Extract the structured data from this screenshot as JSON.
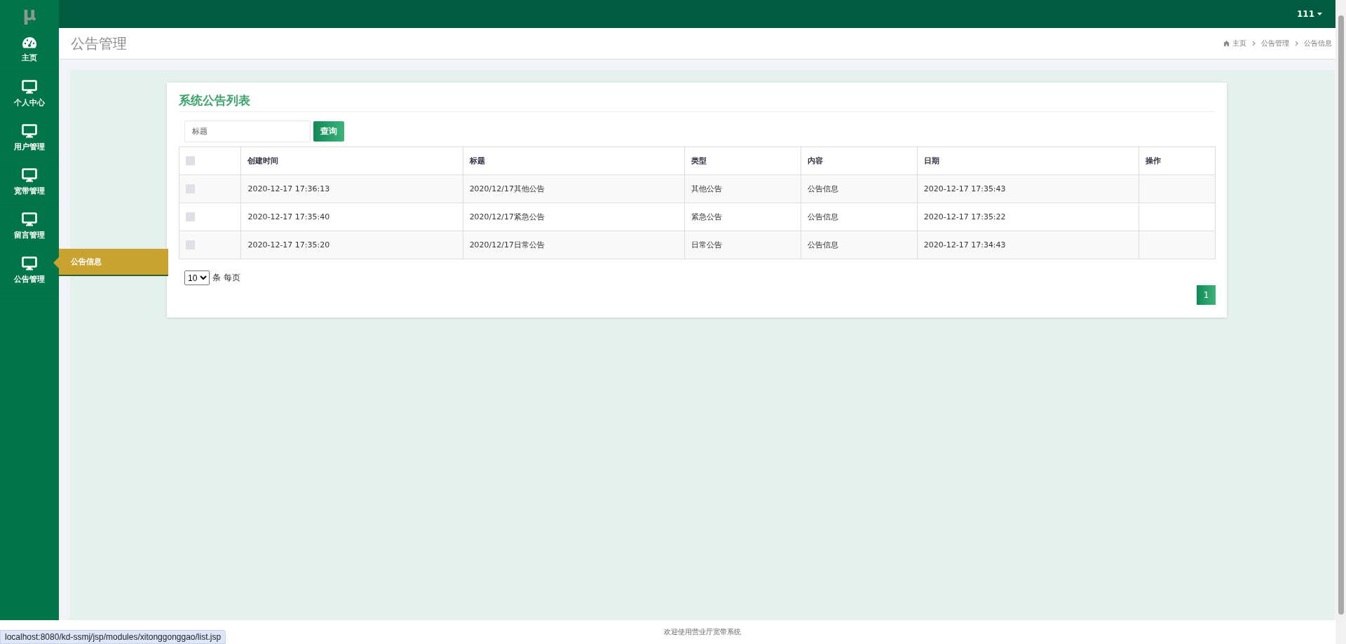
{
  "logo": "μ",
  "user_menu": {
    "label": "111"
  },
  "sidebar": {
    "items": [
      {
        "label": "主页",
        "kind": "dashboard",
        "expanded": false
      },
      {
        "label": "个人中心",
        "kind": "monitor",
        "expanded": false
      },
      {
        "label": "用户管理",
        "kind": "monitor",
        "expanded": false
      },
      {
        "label": "宽带管理",
        "kind": "monitor",
        "expanded": false
      },
      {
        "label": "留言管理",
        "kind": "monitor",
        "expanded": false
      },
      {
        "label": "公告管理",
        "kind": "monitor",
        "expanded": true,
        "submenu": [
          "公告信息"
        ]
      }
    ]
  },
  "page_title": "公告管理",
  "breadcrumb": [
    "主页",
    "公告管理",
    "公告信息"
  ],
  "card": {
    "title": "系统公告列表",
    "search": {
      "placeholder": "标题",
      "button": "查询"
    },
    "table": {
      "columns": [
        "创建时间",
        "标题",
        "类型",
        "内容",
        "日期",
        "操作"
      ],
      "header_checked": false,
      "rows": [
        {
          "checked": false,
          "cells": [
            "2020-12-17 17:36:13",
            "2020/12/17其他公告",
            "其他公告",
            "公告信息",
            "2020-12-17 17:35:43",
            ""
          ]
        },
        {
          "checked": false,
          "cells": [
            "2020-12-17 17:35:40",
            "2020/12/17紧急公告",
            "紧急公告",
            "公告信息",
            "2020-12-17 17:35:22",
            ""
          ]
        },
        {
          "checked": false,
          "cells": [
            "2020-12-17 17:35:20",
            "2020/12/17日常公告",
            "日常公告",
            "公告信息",
            "2020-12-17 17:34:43",
            ""
          ]
        }
      ]
    },
    "page_size": {
      "value": "10",
      "label": "条 每页"
    },
    "pages": [
      {
        "label": "1",
        "selected": true
      }
    ]
  },
  "footer": "欢迎使用营业厅宽带系统",
  "status_url": "localhost:8080/kd-ssmj/jsp/modules/xitonggonggao/list.jsp"
}
